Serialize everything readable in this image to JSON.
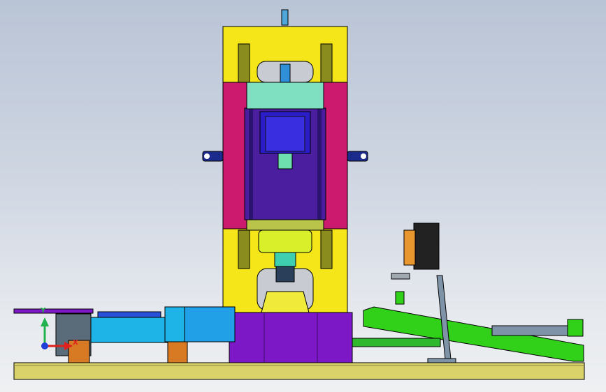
{
  "view": {
    "background_top": "#b9c4d6",
    "background_bottom": "#eef0f2"
  },
  "triad": {
    "x_label": "X",
    "y_label": "Y",
    "x_color": "#e0201c",
    "y_color": "#22b14c",
    "origin_color": "#1f3fd9"
  },
  "colors": {
    "frame_yellow": "#f5e61a",
    "plate_magenta": "#cc1a6e",
    "motor_purple": "#4a1e9e",
    "motor_blue": "#2a1dc8",
    "cylinder_cyan": "#1fb4e8",
    "mint": "#7ee0c0",
    "lime": "#d8ef2a",
    "violet_block": "#7d18c6",
    "green_ramp": "#31d11a",
    "base_plate": "#d9d26a",
    "steel_blue": "#7f93a8"
  }
}
